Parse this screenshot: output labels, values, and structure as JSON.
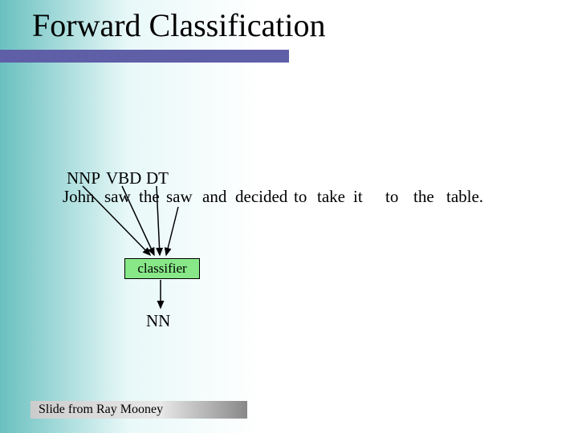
{
  "title": "Forward Classification",
  "tags": {
    "t1": "NNP",
    "t2": "VBD",
    "t3": "DT"
  },
  "words": {
    "w1": "John",
    "w2": "saw",
    "w3": "the",
    "w4": "saw",
    "w5": "and",
    "w6": "decided",
    "w7": "to",
    "w8": "take",
    "w9": "it",
    "w10": "to",
    "w11": "the",
    "w12": "table."
  },
  "classifier_label": "classifier",
  "output_tag": "NN",
  "footer": "Slide from Ray Mooney"
}
